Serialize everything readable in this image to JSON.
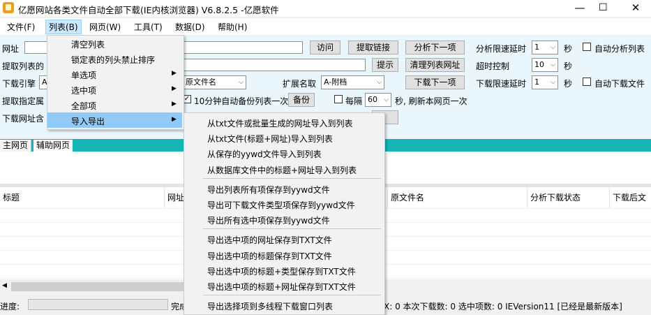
{
  "window": {
    "title": "亿愿网站各类文件自动全部下载(IE内核浏览器) V6.8.2.5 -亿愿软件",
    "controls": {
      "minimize": "—",
      "maximize": "☐",
      "close": "✕"
    }
  },
  "menubar": [
    "文件(F)",
    "列表(B)",
    "网页(W)",
    "工具(T)",
    "数据(D)",
    "帮助(H)"
  ],
  "toolbar": {
    "url_label": "网址",
    "visit_btn": "访问",
    "extract_link_btn": "提取链接",
    "analyze_next_btn": "分析下一项",
    "analyze_delay_label": "分析限速延时",
    "analyze_delay_value": "1",
    "seconds1": "秒",
    "auto_analyze_label": "自动分析列表",
    "extract_list_label": "提取列表的",
    "hint_btn": "提示",
    "clear_list_url_btn": "清理列表网址",
    "timeout_label": "超时控制",
    "timeout_value": "10",
    "seconds2": "秒",
    "engine_label": "下载引擎",
    "engine_value": "A",
    "filename_value": "原文件名",
    "ext_label": "扩展名取",
    "ext_value": "A-附档",
    "download_next_btn": "下载下一项",
    "download_delay_label": "下载限速延时",
    "download_delay_value": "1",
    "seconds3": "秒",
    "auto_download_label": "自动下载文件",
    "extract_attr_label": "提取指定属",
    "autobackup_label": "10分钟自动备份列表一次",
    "backup_btn": "备份",
    "every_label": "每隔",
    "every_value": "60",
    "refresh_label": "秒, 刷新本网页一次",
    "download_url_label": "下载网址含",
    "tab_main": "主网页",
    "tab_aux": "辅助网页"
  },
  "grid_headers": [
    "标题",
    "网址",
    "原文件名",
    "分析下载状态",
    "下载后文"
  ],
  "status": {
    "progress_label": "进度:",
    "done_label": "完成",
    "count_text": "X: 0  本次下载数: 0  选中项数: 0  IEVersion11  [已经是最新版本]"
  },
  "list_menu": {
    "items": [
      "清空列表",
      "锁定表的列头禁止排序",
      "单选项",
      "选中项",
      "全部项",
      "导入导出"
    ],
    "has_sub": [
      false,
      false,
      true,
      true,
      true,
      true
    ],
    "highlighted": "导入导出"
  },
  "submenu": {
    "group1": [
      "从txt文件或批量生成的网址导入到列表",
      "从txt文件(标题+网址)导入到列表",
      "从保存的yywd文件导入到列表",
      "从数据库文件中的标题+网址导入到列表"
    ],
    "group2": [
      "导出列表所有项保存到yywd文件",
      "导出可下载文件类型项保存到yywd文件",
      "导出所有选中项保存到yywd文件"
    ],
    "group3": [
      "导出选中项的网址保存到TXT文件",
      "导出选中项的标题保存到TXT文件",
      "导出选中项的标题+类型保存到TXT文件",
      "导出选中项的标题+网址保存到TXT文件"
    ],
    "group4": [
      "导出选择项到多线程下载窗口列表"
    ]
  }
}
